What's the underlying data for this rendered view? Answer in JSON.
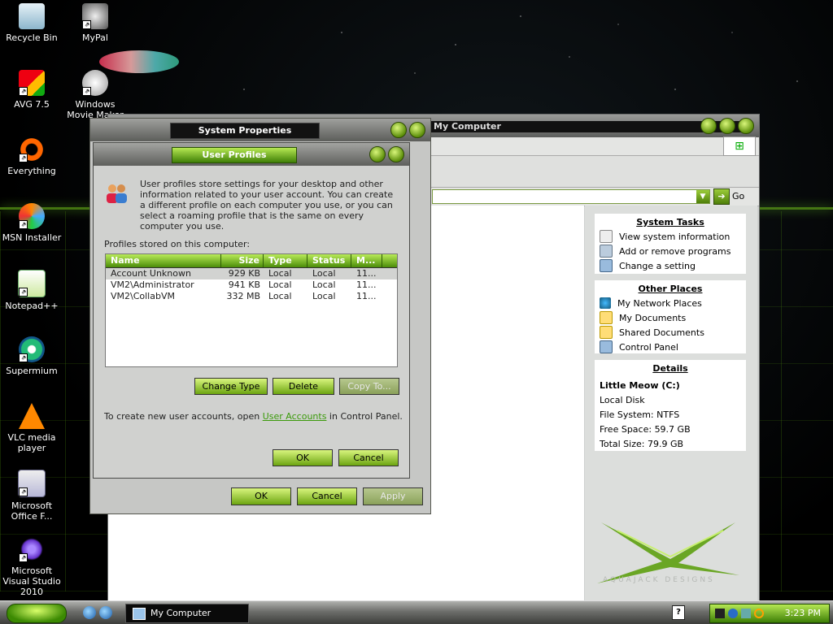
{
  "desktop": {
    "icons": [
      {
        "label": "Recycle Bin"
      },
      {
        "label": "MyPal"
      },
      {
        "label": "AVG 7.5"
      },
      {
        "label": "Windows Movie Maker"
      },
      {
        "label": "Everything"
      },
      {
        "label": "MSN Installer"
      },
      {
        "label": "Notepad++"
      },
      {
        "label": "Supermium"
      },
      {
        "label": "VLC media player"
      },
      {
        "label": "Microsoft Office F..."
      },
      {
        "label": "Microsoft Visual Studio 2010"
      }
    ]
  },
  "explorer": {
    "title": "My Computer",
    "go_label": "Go",
    "system_tasks": {
      "heading": "System Tasks",
      "items": [
        "View system information",
        "Add or remove programs",
        "Change a setting"
      ]
    },
    "other_places": {
      "heading": "Other Places",
      "items": [
        "My Network Places",
        "My Documents",
        "Shared Documents",
        "Control Panel"
      ]
    },
    "details": {
      "heading": "Details",
      "name": "Little Meow (C:)",
      "type": "Local Disk",
      "filesystem": "File System: NTFS",
      "free": "Free Space: 59.7 GB",
      "total": "Total Size: 79.9 GB"
    },
    "brand": "AQUAJACK DESIGNS"
  },
  "system_properties": {
    "title": "System Properties",
    "ok": "OK",
    "cancel": "Cancel",
    "apply": "Apply"
  },
  "user_profiles": {
    "title": "User Profiles",
    "description": "User profiles store settings for your desktop and other information related to your user account. You can create a different profile on each computer you use, or you can select a roaming profile that is the same on every computer you use.",
    "stored_label": "Profiles stored on this computer:",
    "columns": {
      "name": "Name",
      "size": "Size",
      "type": "Type",
      "status": "Status",
      "modified": "M..."
    },
    "rows": [
      {
        "name": "Account Unknown",
        "size": "929 KB",
        "type": "Local",
        "status": "Local",
        "modified": "11..."
      },
      {
        "name": "VM2\\Administrator",
        "size": "941 KB",
        "type": "Local",
        "status": "Local",
        "modified": "11..."
      },
      {
        "name": "VM2\\CollabVM",
        "size": "332 MB",
        "type": "Local",
        "status": "Local",
        "modified": "11..."
      }
    ],
    "change_type": "Change Type",
    "delete": "Delete",
    "copy_to": "Copy To...",
    "note_prefix": "To create new user accounts, open ",
    "note_link": "User Accounts",
    "note_suffix": " in Control Panel.",
    "ok": "OK",
    "cancel": "Cancel"
  },
  "taskbar": {
    "task_label": "My Computer",
    "clock": "3:23 PM",
    "help": "?"
  },
  "colors": {
    "accent": "#6ca511",
    "title_dark": "#121212"
  }
}
